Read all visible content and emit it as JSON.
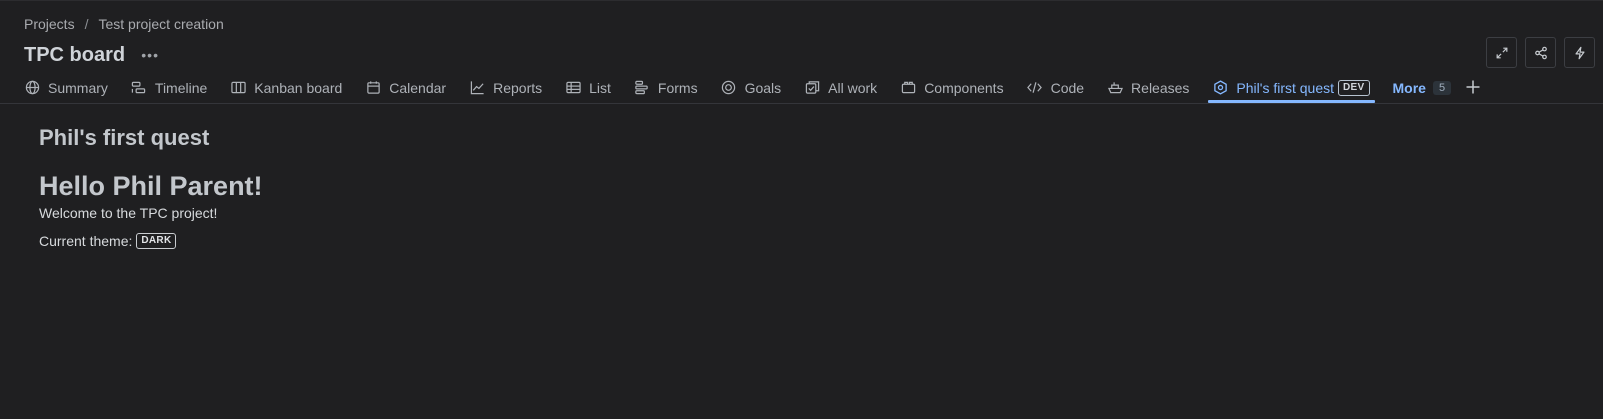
{
  "breadcrumb": {
    "items": [
      "Projects",
      "Test project creation"
    ],
    "separator": "/"
  },
  "header": {
    "title": "TPC board",
    "more_icon": "ellipsis-icon"
  },
  "actions": [
    {
      "icon": "expand-icon"
    },
    {
      "icon": "share-icon"
    },
    {
      "icon": "lightning-icon"
    }
  ],
  "tabs": [
    {
      "label": "Summary",
      "icon": "globe-icon"
    },
    {
      "label": "Timeline",
      "icon": "timeline-icon"
    },
    {
      "label": "Kanban board",
      "icon": "board-icon"
    },
    {
      "label": "Calendar",
      "icon": "calendar-icon"
    },
    {
      "label": "Reports",
      "icon": "chart-icon"
    },
    {
      "label": "List",
      "icon": "list-icon"
    },
    {
      "label": "Forms",
      "icon": "forms-icon"
    },
    {
      "label": "Goals",
      "icon": "target-icon"
    },
    {
      "label": "All work",
      "icon": "all-work-icon"
    },
    {
      "label": "Components",
      "icon": "component-icon"
    },
    {
      "label": "Code",
      "icon": "code-icon"
    },
    {
      "label": "Releases",
      "icon": "ship-icon"
    },
    {
      "label": "Phil's first quest",
      "icon": "hexagon-icon",
      "badge": "DEV",
      "active": true
    }
  ],
  "more_tab": {
    "label": "More",
    "count": "5"
  },
  "main": {
    "quest_title": "Phil's first quest",
    "greeting": "Hello Phil Parent!",
    "welcome": "Welcome to the TPC project!",
    "theme_label": "Current theme:",
    "theme_value": "DARK"
  },
  "colors": {
    "background": "#1f1f21",
    "accent": "#85b8ff",
    "text": "#b6c2cf"
  }
}
